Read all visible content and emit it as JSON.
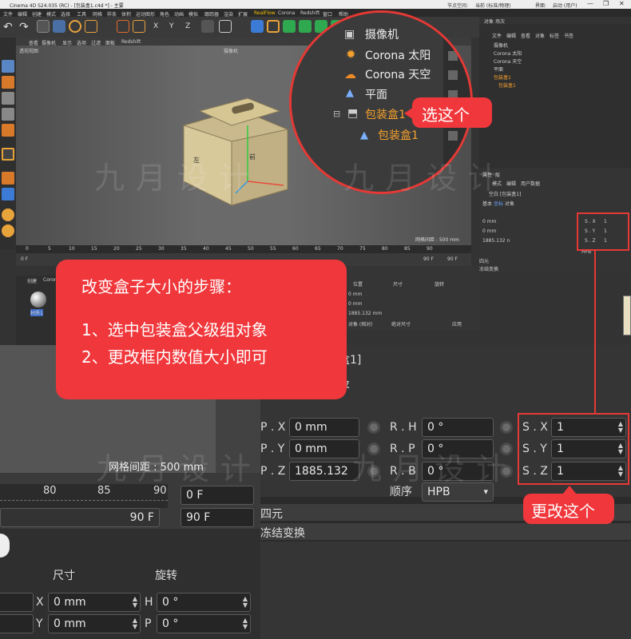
{
  "window": {
    "title": "Cinema 4D S24.035 (RC) - [包装盒1.c4d *] - 主要",
    "node_label": "节点空间:",
    "node_value": "当前 (标准/物理)",
    "interface_label": "界面:",
    "interface_value": "启动 (用户)"
  },
  "menubar": [
    "文件",
    "编辑",
    "创建",
    "模式",
    "选择",
    "工具",
    "网格",
    "样条",
    "体积",
    "运动图形",
    "角色",
    "动画",
    "模拟",
    "跟踪器",
    "渲染",
    "扩展",
    "RealFlow",
    "Corona",
    "Redshift",
    "窗口",
    "帮助"
  ],
  "viewport": {
    "menu": [
      "查看",
      "摄像机",
      "显示",
      "选项",
      "过滤",
      "面板",
      "Redshift"
    ],
    "label": "透视视图",
    "camera": "摄像机",
    "grid_small": "网格间距 : 500 mm",
    "box_label_front": "前",
    "box_label_left": "左"
  },
  "timeline": {
    "ticks": [
      "0",
      "5",
      "10",
      "15",
      "20",
      "25",
      "30",
      "35",
      "40",
      "45",
      "50",
      "55",
      "60",
      "65",
      "70",
      "75",
      "80",
      "85",
      "90"
    ],
    "frame_start": "0 F",
    "frame_end": "90 F",
    "frame_end2": "90 F"
  },
  "object_manager": {
    "tabs": [
      "对象",
      "场次"
    ],
    "menu": [
      "文件",
      "编辑",
      "查看",
      "对象",
      "标签",
      "书签"
    ],
    "items": [
      {
        "label": "摄像机"
      },
      {
        "label": "Corona 太阳"
      },
      {
        "label": "Corona 天空"
      },
      {
        "label": "平面"
      },
      {
        "label": "包装盒1"
      },
      {
        "label": "包装盒1"
      }
    ]
  },
  "attributes": {
    "tabs": [
      "属性",
      "层"
    ],
    "menu": [
      "模式",
      "编辑",
      "用户数据"
    ],
    "object": "空白 [包装盒1]",
    "subtabs": [
      "基本",
      "坐标",
      "对象"
    ],
    "rows": [
      {
        "p": "P . X",
        "pv": "0 mm",
        "r": "R . H",
        "rv": "0 °",
        "s": "S . X",
        "sv": "1"
      },
      {
        "p": "P . Y",
        "pv": "0 mm",
        "r": "R . P",
        "rv": "0 °",
        "s": "S . Y",
        "sv": "1"
      },
      {
        "p": "P . Z",
        "pv": "1885.132 n",
        "r": "R . B",
        "rv": "0 °",
        "s": "S . Z",
        "sv": "1"
      }
    ],
    "order_label": "顺序",
    "order_value": "HPB",
    "quaternion": "四元",
    "freeze": "冻结变换"
  },
  "materials": {
    "menu": [
      "创建",
      "Corona"
    ],
    "mat1": "材质1"
  },
  "coords": {
    "headers": [
      "位置",
      "尺寸",
      "旋转"
    ],
    "size_header": "尺寸",
    "rot_header": "旋转",
    "pos_vals": [
      "0 mm",
      "0 mm",
      "1885.132 mm"
    ],
    "size_labels": [
      "X",
      "Y",
      "Z"
    ],
    "size_vals": [
      "0 mm",
      "0 mm",
      "0 mm"
    ],
    "rot_labels": [
      "H",
      "P",
      "B"
    ],
    "rot_vals": [
      "0 °",
      "0 °",
      "0 °"
    ],
    "mode_object": "对象 (相对)",
    "mode_abs": "绝对尺寸",
    "apply": "应用"
  },
  "bottom": {
    "ticks": [
      "80",
      "85",
      "90"
    ],
    "frame_left": "90 F",
    "frame_right": "90 F",
    "frame_top_right": "0 F",
    "grid_label": "网格间距 : 500 mm",
    "attr_partial": "盒1]",
    "obj_partial": "及"
  },
  "magnifier": {
    "items": [
      "摄像机",
      "Corona 太阳",
      "Corona 天空",
      "平面",
      "包装盒1",
      "包装盒1"
    ]
  },
  "callouts": {
    "select": "选这个",
    "change": "更改这个",
    "steps_title": "改变盒子大小的步骤：",
    "step1": "1、选中包装盒父级组对象",
    "step2": "2、更改框内数值大小即可"
  },
  "watermark": "九月设计",
  "colors": {
    "accent_red": "#f0373b",
    "selected_orange": "#f5a12d"
  }
}
